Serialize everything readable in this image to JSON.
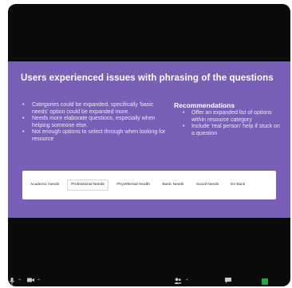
{
  "slide": {
    "title": "Users experienced issues with phrasing of the questions",
    "left_bullets": [
      "Categories could be expanded, specifically 'basic needs' option could be expanded more.",
      "Needs more elaborate questions, especially when helping someone else.",
      "Not enough options to select through when looking for resource"
    ],
    "recommendations": {
      "heading": "Recommendations",
      "items": [
        "Offer an expanded list of options within resource category",
        "Include 'real person' help if stuck on a question"
      ]
    },
    "nav_options": [
      "Academic Needs",
      "Professional Needs",
      "Phys/Mental Health",
      "Basic Needs",
      "Social Needs",
      "Go Back"
    ],
    "selected_option_index": 1
  },
  "icons": {
    "mic": "microphone-icon",
    "video": "video-camera-icon",
    "participants": "participants-icon",
    "chat": "chat-icon",
    "share": "share-screen-icon"
  },
  "colors": {
    "slide_background": "#7a5fb6",
    "window_background": "#0b0b0b",
    "share_green": "#1ea84b"
  }
}
